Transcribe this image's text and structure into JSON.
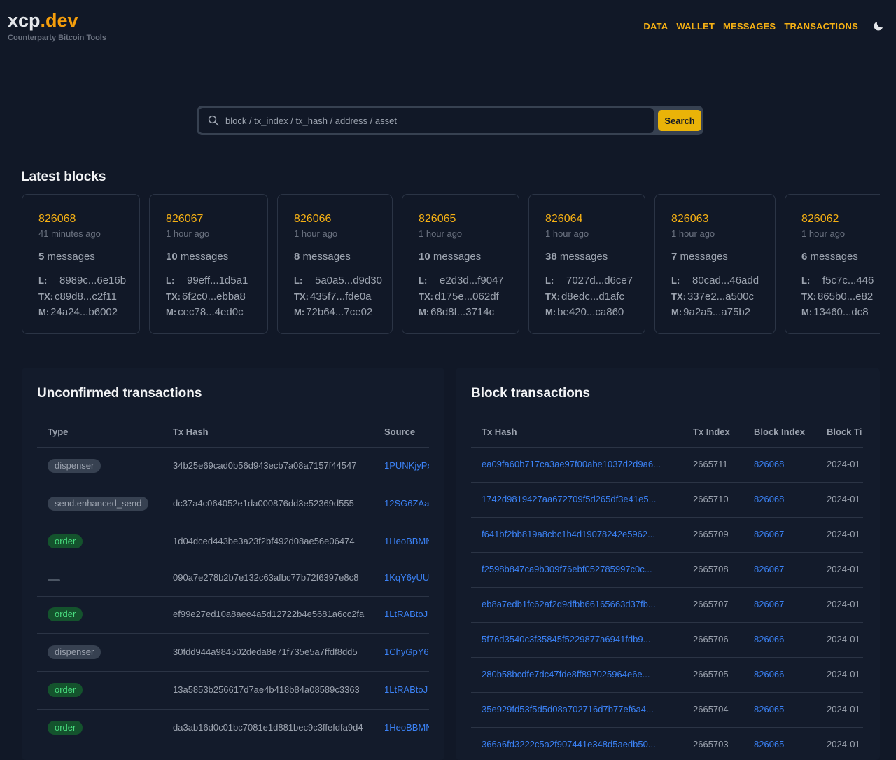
{
  "brand": {
    "name_part1": "xcp",
    "name_part2": ".dev",
    "tagline": "Counterparty Bitcoin Tools"
  },
  "nav": {
    "items": [
      "DATA",
      "WALLET",
      "MESSAGES",
      "TRANSACTIONS"
    ],
    "theme_icon": "moon-icon"
  },
  "search": {
    "placeholder": "block / tx_index / tx_hash / address / asset",
    "value": "",
    "button_label": "Search"
  },
  "latest_blocks": {
    "title": "Latest blocks",
    "messages_word": "messages",
    "labels": {
      "ledger": "L:",
      "tx": "TX:",
      "msg": "M:"
    },
    "blocks": [
      {
        "height": "826068",
        "ago": "41 minutes ago",
        "messages": "5",
        "l": "8989c...6e16b",
        "tx": "c89d8...c2f11",
        "m": "24a24...b6002"
      },
      {
        "height": "826067",
        "ago": "1 hour ago",
        "messages": "10",
        "l": "99eff...1d5a1",
        "tx": "6f2c0...ebba8",
        "m": "cec78...4ed0c"
      },
      {
        "height": "826066",
        "ago": "1 hour ago",
        "messages": "8",
        "l": "5a0a5...d9d30",
        "tx": "435f7...fde0a",
        "m": "72b64...7ce02"
      },
      {
        "height": "826065",
        "ago": "1 hour ago",
        "messages": "10",
        "l": "e2d3d...f9047",
        "tx": "d175e...062df",
        "m": "68d8f...3714c"
      },
      {
        "height": "826064",
        "ago": "1 hour ago",
        "messages": "38",
        "l": "7027d...d6ce7",
        "tx": "d8edc...d1afc",
        "m": "be420...ca860"
      },
      {
        "height": "826063",
        "ago": "1 hour ago",
        "messages": "7",
        "l": "80cad...46add",
        "tx": "337e2...a500c",
        "m": "9a2a5...a75b2"
      },
      {
        "height": "826062",
        "ago": "1 hour ago",
        "messages": "6",
        "l": "f5c7c...446",
        "tx": "865b0...e82",
        "m": "13460...dc8"
      }
    ]
  },
  "unconfirmed": {
    "title": "Unconfirmed transactions",
    "columns": [
      "Type",
      "Tx Hash",
      "Source"
    ],
    "rows": [
      {
        "type": "dispenser",
        "style": "gray",
        "hash": "34b25e69cad0b56d943ecb7a08a7157f44547",
        "source": "1PUNKjyPx"
      },
      {
        "type": "send.enhanced_send",
        "style": "gray",
        "hash": "dc37a4c064052e1da000876dd3e52369d555",
        "source": "12SG6ZAa"
      },
      {
        "type": "order",
        "style": "green",
        "hash": "1d04dced443be3a23f2bf492d08ae56e06474",
        "source": "1HeoBBMN"
      },
      {
        "type": "",
        "style": "dash",
        "hash": "090a7e278b2b7e132c63afbc77b72f6397e8c8",
        "source": "1KqY6yUU"
      },
      {
        "type": "order",
        "style": "green",
        "hash": "ef99e27ed10a8aee4a5d12722b4e5681a6cc2fa",
        "source": "1LtRABtoJ"
      },
      {
        "type": "dispenser",
        "style": "gray",
        "hash": "30fdd944a984502deda8e71f735e5a7ffdf8dd5",
        "source": "1ChyGpY6"
      },
      {
        "type": "order",
        "style": "green",
        "hash": "13a5853b256617d7ae4b418b84a08589c3363",
        "source": "1LtRABtoJ"
      },
      {
        "type": "order",
        "style": "green",
        "hash": "da3ab16d0c01bc7081e1d881bec9c3ffefdfa9d4",
        "source": "1HeoBBMN"
      }
    ]
  },
  "block_transactions": {
    "title": "Block transactions",
    "columns": [
      "Tx Hash",
      "Tx Index",
      "Block Index",
      "Block Ti"
    ],
    "rows": [
      {
        "hash": "ea09fa60b717ca3ae97f00abe1037d2d9a6...",
        "tx_index": "2665711",
        "block_index": "826068",
        "time": "2024-01"
      },
      {
        "hash": "1742d9819427aa672709f5d265df3e41e5...",
        "tx_index": "2665710",
        "block_index": "826068",
        "time": "2024-01"
      },
      {
        "hash": "f641bf2bb819a8cbc1b4d19078242e5962...",
        "tx_index": "2665709",
        "block_index": "826067",
        "time": "2024-01"
      },
      {
        "hash": "f2598b847ca9b309f76ebf052785997c0c...",
        "tx_index": "2665708",
        "block_index": "826067",
        "time": "2024-01"
      },
      {
        "hash": "eb8a7edb1fc62af2d9dfbb66165663d37fb...",
        "tx_index": "2665707",
        "block_index": "826067",
        "time": "2024-01"
      },
      {
        "hash": "5f76d3540c3f35845f5229877a6941fdb9...",
        "tx_index": "2665706",
        "block_index": "826066",
        "time": "2024-01"
      },
      {
        "hash": "280b58bcdfe7dc47fde8ff897025964e6e...",
        "tx_index": "2665705",
        "block_index": "826066",
        "time": "2024-01"
      },
      {
        "hash": "35e929fd53f5d5d08a702716d7b77ef6a4...",
        "tx_index": "2665704",
        "block_index": "826065",
        "time": "2024-01"
      },
      {
        "hash": "366a6fd3222c5a2f907441e348d5aedb50...",
        "tx_index": "2665703",
        "block_index": "826065",
        "time": "2024-01"
      }
    ]
  },
  "colors": {
    "accent": "#f59e0b",
    "link": "#3b82f6",
    "bg": "#111827",
    "panel": "#131b2b",
    "badge_green": "#4ade80"
  }
}
